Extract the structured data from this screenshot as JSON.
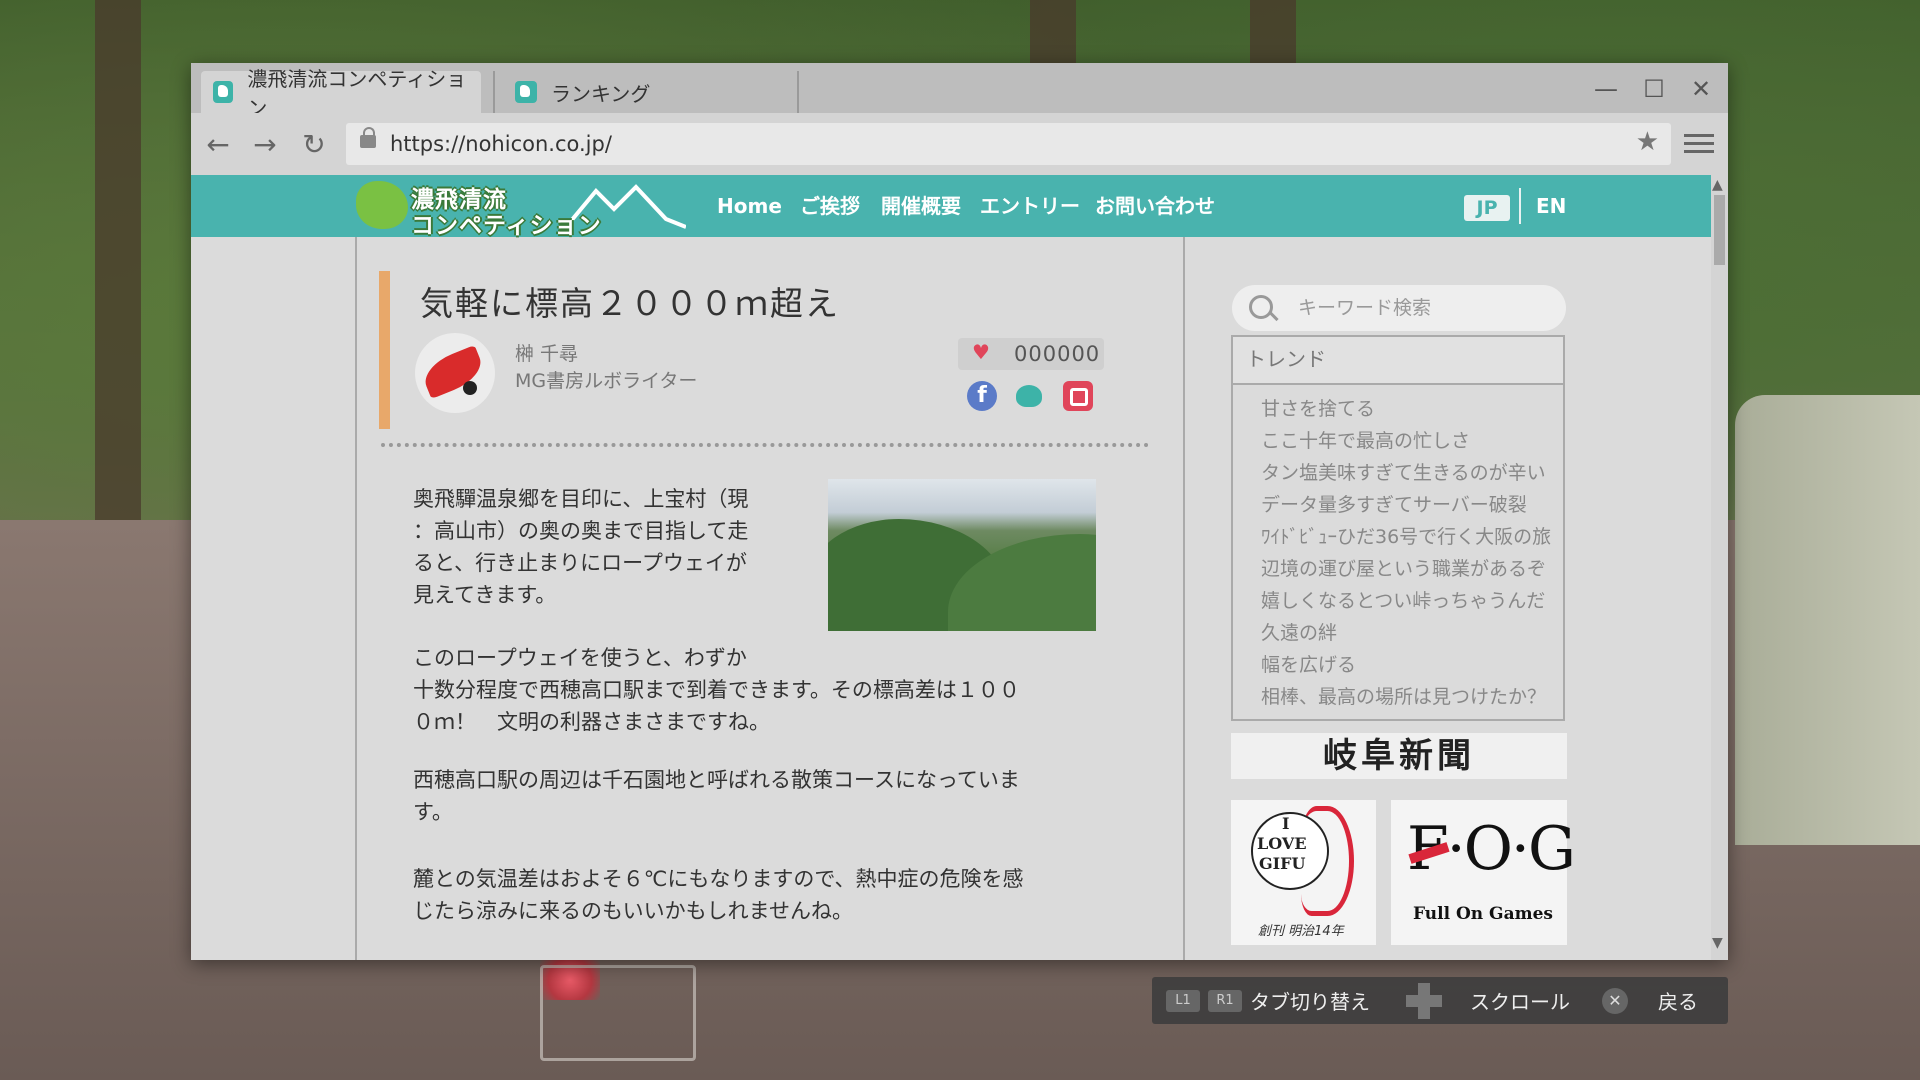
{
  "browser": {
    "tabs": [
      {
        "label": "濃飛清流コンペティション",
        "active": true
      },
      {
        "label": "ランキング",
        "active": false
      }
    ],
    "url": "https://nohicon.co.jp/",
    "controls": {
      "minimize": "—",
      "maximize": "☐",
      "close": "✕"
    },
    "nav": {
      "back": "←",
      "forward": "→",
      "reload": "↻",
      "bookmark": "★"
    }
  },
  "site": {
    "logo_line1": "濃飛清流",
    "logo_line2": "コンペティション",
    "nav": [
      "Home",
      "ご挨拶",
      "開催概要",
      "エントリー",
      "お問い合わせ"
    ],
    "lang_jp": "JP",
    "lang_en": "EN",
    "brand_color": "#49b3ae"
  },
  "article": {
    "title": "気軽に標高２０００ｍ超え",
    "author": "榊 千尋",
    "role": "MG書房ルボライター",
    "likes": "000000",
    "social": [
      "facebook-icon",
      "bird-icon",
      "instagram-icon"
    ],
    "paragraph1": [
      "奥飛驒温泉郷を目印に、上宝村（現",
      "：高山市）の奥の奥まで目指して走",
      "ると、行き止まりにロープウェイが",
      "見えてきます。"
    ],
    "paragraph2": [
      "このロープウェイを使うと、わずか",
      "十数分程度で西穂高口駅まで到着できます。その標高差は１００",
      "０ｍ！　文明の利器さまさまですね。"
    ],
    "paragraph3": [
      "西穂高口駅の周辺は千石園地と呼ばれる散策コースになっていま",
      "す。"
    ],
    "paragraph4": [
      "麓との気温差はおよそ６℃にもなりますので、熱中症の危険を感",
      "じたら涼みに来るのもいいかもしれませんね。"
    ]
  },
  "sidebar": {
    "search_placeholder": "キーワード検索",
    "trend_title": "トレンド",
    "trends": [
      "甘さを捨てる",
      "ここ十年で最高の忙しさ",
      "タン塩美味すぎて生きるのが辛い",
      "データ量多すぎてサーバー破裂",
      "ﾜｲﾄﾞﾋﾞｭｰひだ36号で行く大阪の旅",
      "辺境の運び屋という職業があるぞ",
      "嬉しくなるとつい峠っちゃうんだ",
      "久遠の絆",
      "幅を広げる",
      "相棒、最高の場所は見つけたか？"
    ],
    "sponsor_newspaper": "岐阜新聞",
    "love_lines": [
      "I",
      "LOVE",
      "GIFU"
    ],
    "love_caption": "創刊 明治14年",
    "fog_logo": "F·O·G",
    "fog_sub": "Full On Games"
  },
  "hints": {
    "l1": "L1",
    "r1": "R1",
    "tab_switch": "タブ切り替え",
    "scroll": "スクロール",
    "x": "✕",
    "back": "戻る"
  }
}
